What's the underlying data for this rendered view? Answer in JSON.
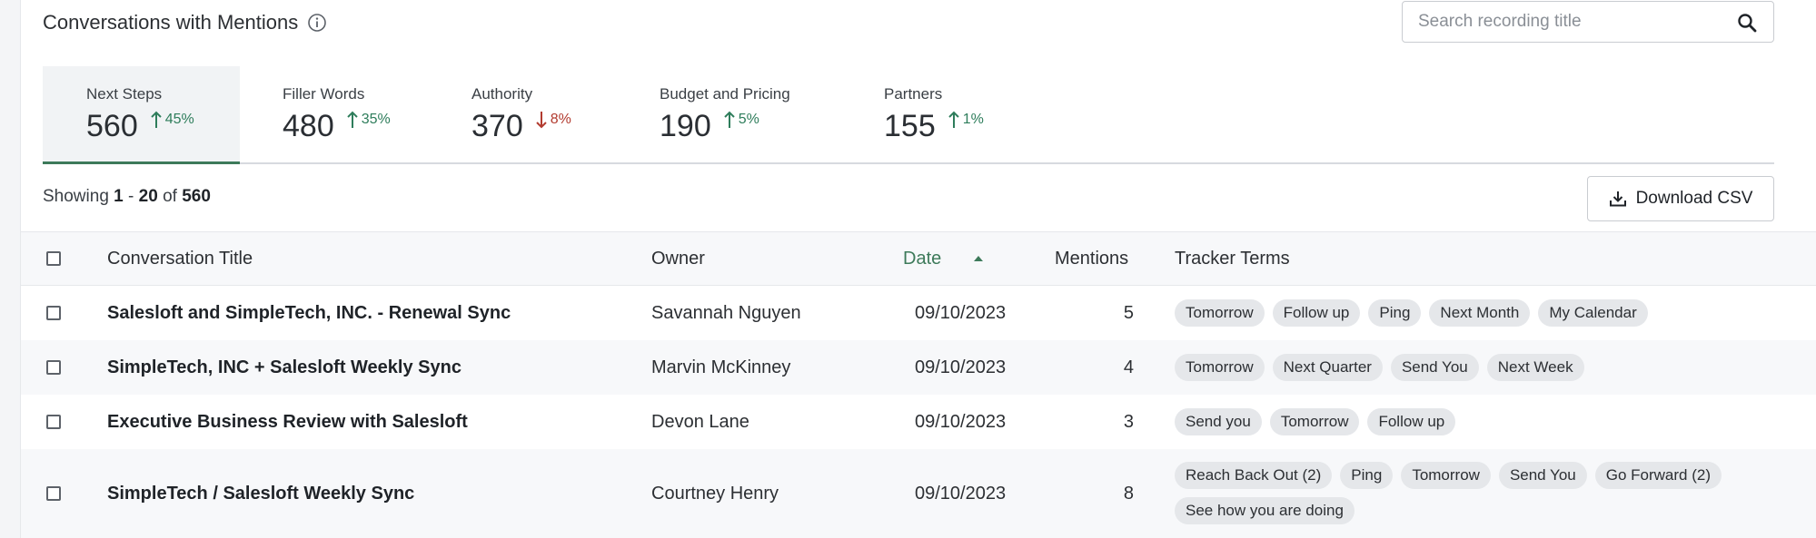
{
  "header": {
    "title": "Conversations with Mentions",
    "search_placeholder": "Search recording title",
    "search_value": ""
  },
  "tabs": [
    {
      "label": "Next Steps",
      "value": "560",
      "delta": "45%",
      "direction": "up",
      "active": true
    },
    {
      "label": "Filler Words",
      "value": "480",
      "delta": "35%",
      "direction": "up",
      "active": false
    },
    {
      "label": "Authority",
      "value": "370",
      "delta": "8%",
      "direction": "down",
      "active": false
    },
    {
      "label": "Budget and Pricing",
      "value": "190",
      "delta": "5%",
      "direction": "up",
      "active": false
    },
    {
      "label": "Partners",
      "value": "155",
      "delta": "1%",
      "direction": "up",
      "active": false
    }
  ],
  "showing": {
    "prefix": "Showing",
    "range_start": "1",
    "dash": "-",
    "range_end": "20",
    "of": "of",
    "total": "560"
  },
  "download_label": "Download CSV",
  "table": {
    "columns": {
      "title": "Conversation Title",
      "owner": "Owner",
      "date": "Date",
      "mentions": "Mentions",
      "terms": "Tracker Terms"
    },
    "sort": {
      "column": "date",
      "direction": "ascending"
    },
    "rows": [
      {
        "title": "Salesloft and SimpleTech, INC. - Renewal Sync",
        "owner": "Savannah Nguyen",
        "date": "09/10/2023",
        "mentions": "5",
        "terms": [
          "Tomorrow",
          "Follow up",
          "Ping",
          "Next Month",
          "My Calendar"
        ]
      },
      {
        "title": "SimpleTech, INC + Salesloft Weekly Sync",
        "owner": "Marvin McKinney",
        "date": "09/10/2023",
        "mentions": "4",
        "terms": [
          "Tomorrow",
          "Next Quarter",
          "Send You",
          "Next Week"
        ]
      },
      {
        "title": "Executive Business Review with Salesloft",
        "owner": "Devon Lane",
        "date": "09/10/2023",
        "mentions": "3",
        "terms": [
          "Send you",
          "Tomorrow",
          "Follow up"
        ]
      },
      {
        "title": "SimpleTech / Salesloft Weekly Sync",
        "owner": "Courtney Henry",
        "date": "09/10/2023",
        "mentions": "8",
        "terms": [
          "Reach Back Out (2)",
          "Ping",
          "Tomorrow",
          "Send You",
          "Go Forward (2)",
          "See how you are doing"
        ]
      }
    ]
  },
  "colors": {
    "accent_green": "#3d7a5a",
    "up": "#2e7d5b",
    "down": "#b23b2f",
    "chip_bg": "#e5e7ea"
  }
}
